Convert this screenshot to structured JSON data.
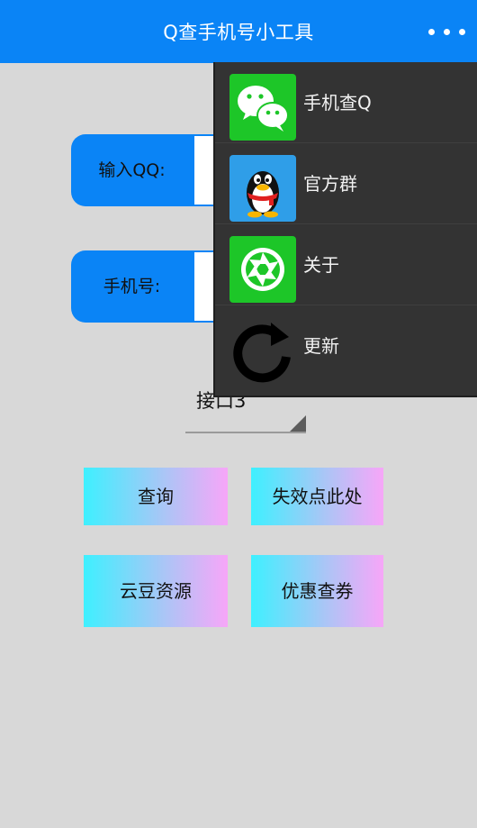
{
  "header": {
    "title": "Q查手机号小工具",
    "more_icon": "more-horizontal-icon"
  },
  "form": {
    "qq_label": "输入QQ:",
    "qq_value": "",
    "phone_label": "手机号:",
    "phone_value": "",
    "interface_select": "接口3"
  },
  "buttons": {
    "query": "查询",
    "invalid_click": "失效点此处",
    "yundou": "云豆资源",
    "coupon": "优惠查券"
  },
  "menu": {
    "items": [
      {
        "label": "手机查Q",
        "icon": "wechat-icon"
      },
      {
        "label": "官方群",
        "icon": "qq-penguin-icon"
      },
      {
        "label": "关于",
        "icon": "camera-aperture-icon"
      },
      {
        "label": "更新",
        "icon": "refresh-icon"
      }
    ]
  },
  "colors": {
    "primary": "#0a84f6",
    "background": "#d8d8d8",
    "menu_bg": "#333333",
    "gradient_start": "#3ef0ff",
    "gradient_end": "#f7a6f8"
  }
}
